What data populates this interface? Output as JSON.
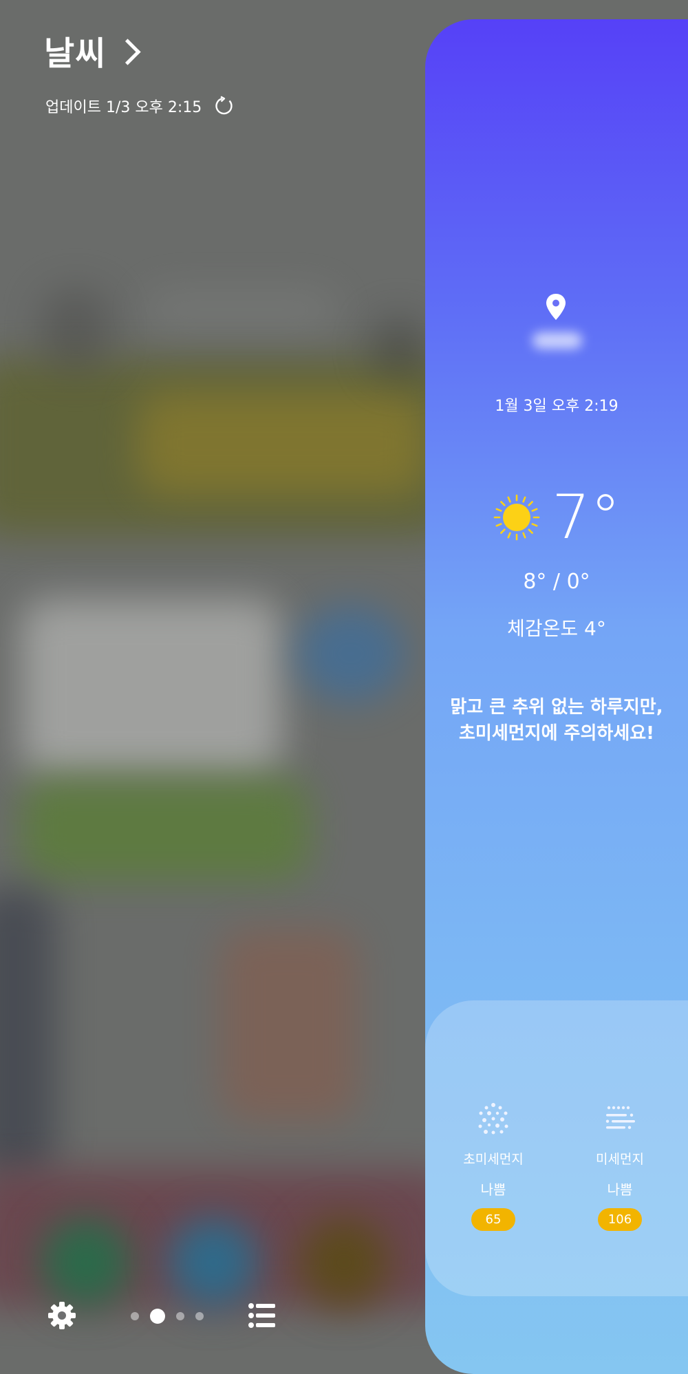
{
  "header": {
    "title": "날씨",
    "update_text": "업데이트 1/3 오후 2:15"
  },
  "weather": {
    "datetime": "1월 3일 오후 2:19",
    "temperature": "7°",
    "high_low": "8° / 0°",
    "feels_like": "체감온도 4°",
    "message_line1": "맑고 큰 추위 없는 하루지만,",
    "message_line2": "초미세먼지에 주의하세요!",
    "condition_icon": "sun-icon"
  },
  "air_quality": {
    "items": [
      {
        "label": "초미세먼지",
        "status": "나쁨",
        "value": "65",
        "icon": "ultrafine-dust-icon"
      },
      {
        "label": "미세먼지",
        "status": "나쁨",
        "value": "106",
        "icon": "fine-dust-icon"
      }
    ],
    "badge_color": "#f2b400"
  },
  "pager": {
    "page_count": 4,
    "active_index": 1
  },
  "colors": {
    "panel_top": "#5641f7",
    "panel_bottom": "#85c6f1",
    "sun": "#fcd116"
  }
}
